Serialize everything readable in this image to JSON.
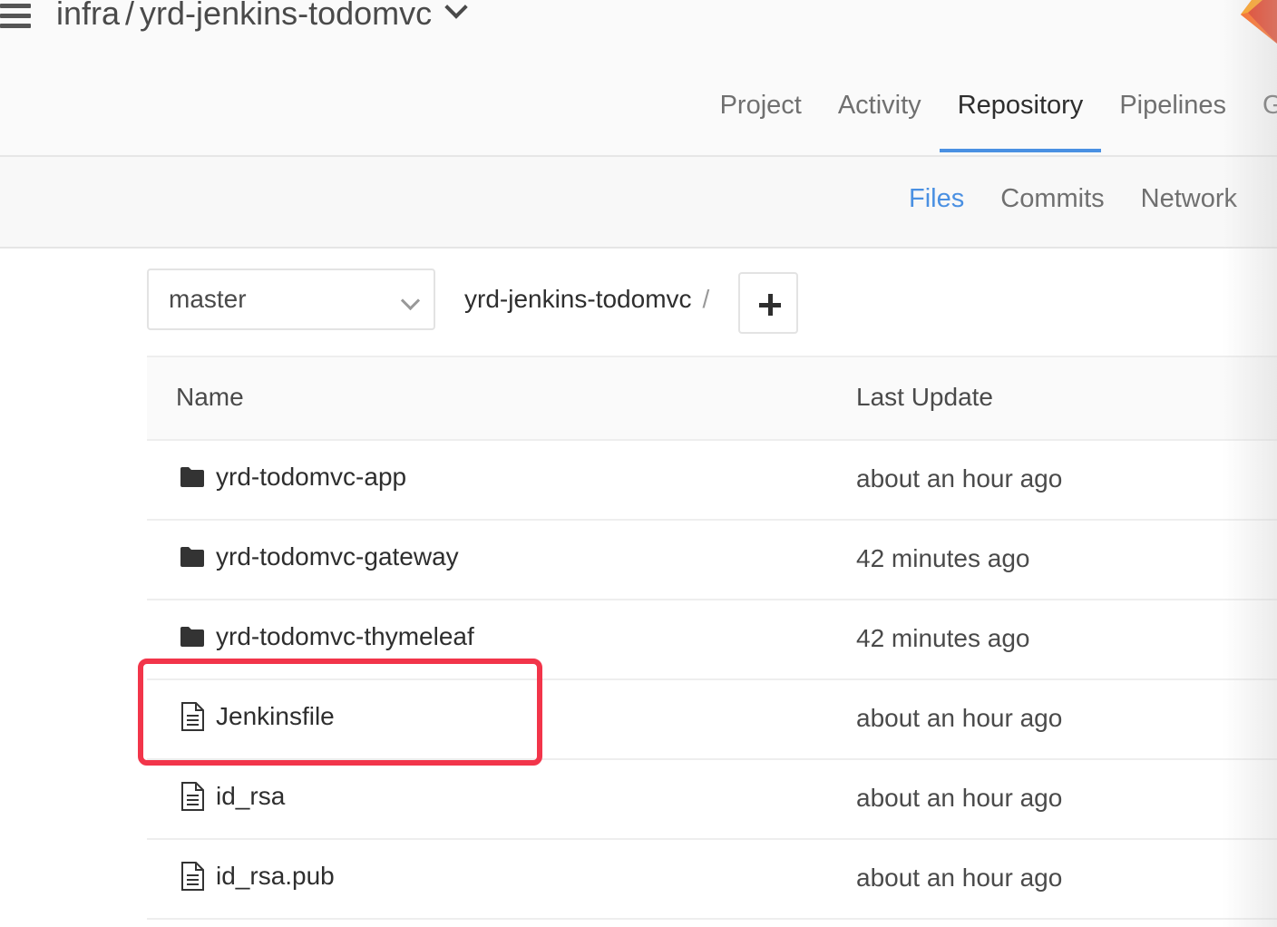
{
  "header": {
    "namespace": "infra",
    "separator": "/",
    "project": "yrd-jenkins-todomvc"
  },
  "main_nav": {
    "tabs": [
      {
        "label": "Project",
        "active": false
      },
      {
        "label": "Activity",
        "active": false
      },
      {
        "label": "Repository",
        "active": true
      },
      {
        "label": "Pipelines",
        "active": false
      },
      {
        "label": "G",
        "active": false
      }
    ]
  },
  "sub_nav": {
    "tabs": [
      {
        "label": "Files",
        "active": true
      },
      {
        "label": "Commits",
        "active": false
      },
      {
        "label": "Network",
        "active": false
      }
    ]
  },
  "branch": {
    "value": "master"
  },
  "breadcrumb": {
    "repo": "yrd-jenkins-todomvc",
    "slash": "/"
  },
  "table": {
    "headers": {
      "name": "Name",
      "last_update": "Last Update"
    },
    "rows": [
      {
        "type": "folder",
        "name": "yrd-todomvc-app",
        "last_update": "about an hour ago"
      },
      {
        "type": "folder",
        "name": "yrd-todomvc-gateway",
        "last_update": "42 minutes ago"
      },
      {
        "type": "folder",
        "name": "yrd-todomvc-thymeleaf",
        "last_update": "42 minutes ago"
      },
      {
        "type": "file",
        "name": "Jenkinsfile",
        "last_update": "about an hour ago"
      },
      {
        "type": "file",
        "name": "id_rsa",
        "last_update": "about an hour ago"
      },
      {
        "type": "file",
        "name": "id_rsa.pub",
        "last_update": "about an hour ago"
      }
    ]
  },
  "colors": {
    "accent": "#4a90e2",
    "highlight": "#f2354a"
  },
  "icons": {
    "menu": "hamburger-icon",
    "folder": "folder-icon",
    "file": "file-icon",
    "add": "plus-icon"
  }
}
